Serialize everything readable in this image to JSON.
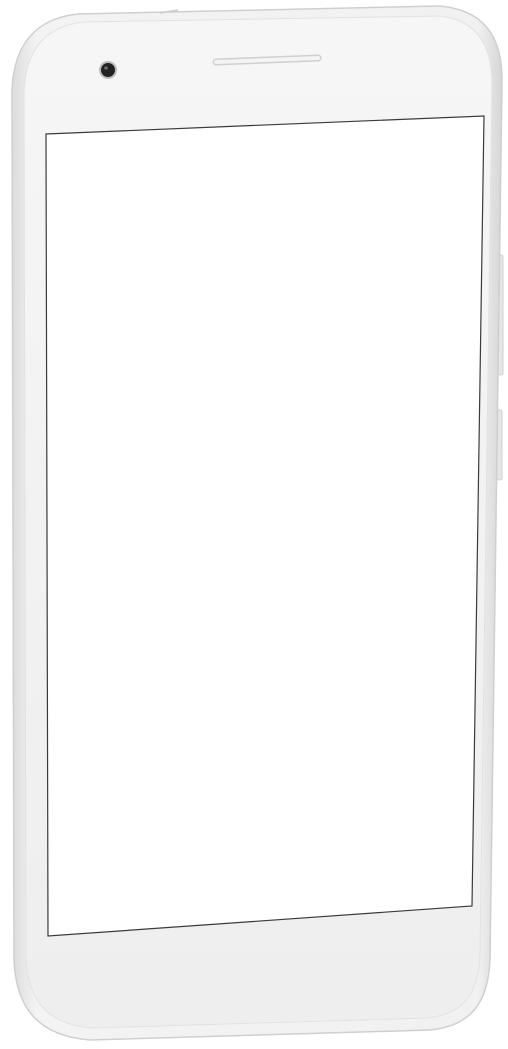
{
  "device": {
    "type": "smartphone mockup",
    "colors": {
      "body": "#efefef",
      "body_edge": "#d9d9d9",
      "bezel": "#f2f2f2",
      "screen": "#ffffff",
      "screen_border": "#3a3a3a",
      "camera": "#222222",
      "speaker": "#dcdcdc"
    },
    "icons": {
      "camera": "front-camera-icon",
      "speaker": "earpiece-speaker-icon"
    },
    "screen_content": ""
  }
}
